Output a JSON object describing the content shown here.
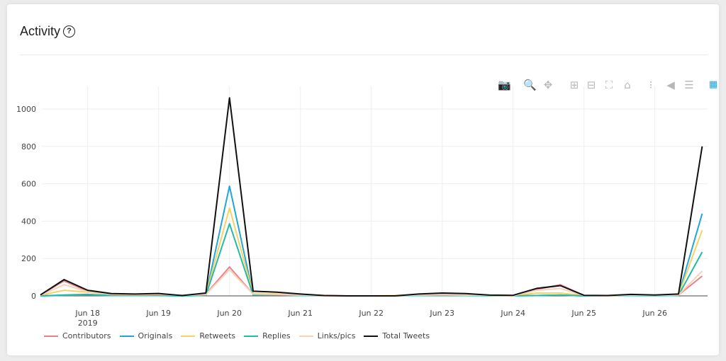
{
  "card": {
    "title": "Activity",
    "help_icon": "question-circle-icon"
  },
  "toolbar": [
    {
      "name": "camera-icon",
      "glyph": "📷",
      "label": "Download plot as png"
    },
    {
      "name": "zoom-icon",
      "glyph": "🔍",
      "label": "Zoom",
      "active": true
    },
    {
      "name": "pan-icon",
      "glyph": "✥",
      "label": "Pan"
    },
    {
      "name": "zoom-in-icon",
      "glyph": "⊞",
      "label": "Zoom in"
    },
    {
      "name": "zoom-out-icon",
      "glyph": "⊟",
      "label": "Zoom out"
    },
    {
      "name": "autoscale-icon",
      "glyph": "⛶",
      "label": "Autoscale"
    },
    {
      "name": "reset-axes-icon",
      "glyph": "⌂",
      "label": "Reset axes"
    },
    {
      "name": "spike-lines-icon",
      "glyph": "⁝",
      "label": "Toggle spike lines"
    },
    {
      "name": "hover-closest-icon",
      "glyph": "◀",
      "label": "Show closest data on hover"
    },
    {
      "name": "hover-compare-icon",
      "glyph": "☰",
      "label": "Compare data on hover"
    },
    {
      "name": "plotly-logo-icon",
      "glyph": "▦",
      "label": "Produced with Plotly"
    }
  ],
  "chart_data": {
    "type": "line",
    "title": "Activity",
    "xlabel": "",
    "ylabel": "",
    "x_unit": "hours since Jun 17 2019 08:00",
    "x_range_hours": [
      0,
      225
    ],
    "ylim": [
      0,
      1080
    ],
    "yticks": [
      0,
      200,
      400,
      600,
      800,
      1000
    ],
    "xticks": [
      {
        "label": "Jun 18",
        "sub": "2019",
        "hour": 16
      },
      {
        "label": "Jun 19",
        "hour": 40
      },
      {
        "label": "Jun 20",
        "hour": 64
      },
      {
        "label": "Jun 21",
        "hour": 88
      },
      {
        "label": "Jun 22",
        "hour": 112
      },
      {
        "label": "Jun 23",
        "hour": 136
      },
      {
        "label": "Jun 24",
        "hour": 160
      },
      {
        "label": "Jun 25",
        "hour": 184
      },
      {
        "label": "Jun 26",
        "hour": 208
      }
    ],
    "grid": true,
    "legend_position": "bottom-left",
    "x": [
      0,
      8,
      16,
      24,
      32,
      40,
      48,
      56,
      64,
      72,
      80,
      88,
      96,
      104,
      112,
      120,
      128,
      136,
      144,
      152,
      160,
      168,
      176,
      184,
      192,
      200,
      208,
      216,
      224
    ],
    "series": [
      {
        "name": "Contributors",
        "color": "#e8828f",
        "values": [
          5,
          80,
          25,
          10,
          8,
          10,
          2,
          10,
          155,
          10,
          10,
          5,
          2,
          0,
          0,
          0,
          5,
          8,
          6,
          2,
          0,
          35,
          60,
          2,
          0,
          5,
          3,
          5,
          106
        ]
      },
      {
        "name": "Originals",
        "color": "#27a4d6",
        "values": [
          0,
          5,
          8,
          2,
          2,
          3,
          0,
          5,
          587,
          8,
          6,
          3,
          0,
          0,
          0,
          0,
          3,
          5,
          3,
          2,
          2,
          2,
          5,
          0,
          0,
          3,
          2,
          5,
          440
        ]
      },
      {
        "name": "Retweets",
        "color": "#f3d366",
        "values": [
          3,
          30,
          20,
          8,
          6,
          8,
          2,
          8,
          470,
          12,
          10,
          5,
          0,
          0,
          0,
          2,
          6,
          8,
          6,
          2,
          0,
          15,
          15,
          2,
          0,
          3,
          2,
          5,
          352
        ]
      },
      {
        "name": "Replies",
        "color": "#26b9a6",
        "values": [
          0,
          3,
          5,
          2,
          2,
          2,
          0,
          3,
          386,
          5,
          4,
          2,
          0,
          0,
          0,
          0,
          2,
          3,
          2,
          0,
          0,
          2,
          4,
          0,
          0,
          2,
          0,
          3,
          235
        ]
      },
      {
        "name": "Links/pics",
        "color": "#f5d2b8",
        "values": [
          3,
          60,
          22,
          8,
          6,
          8,
          2,
          8,
          140,
          10,
          8,
          4,
          0,
          0,
          0,
          0,
          4,
          6,
          4,
          2,
          0,
          30,
          40,
          2,
          0,
          4,
          2,
          5,
          133
        ]
      },
      {
        "name": "Total Tweets",
        "color": "#111111",
        "values": [
          5,
          87,
          30,
          12,
          10,
          13,
          2,
          15,
          1060,
          25,
          20,
          10,
          2,
          0,
          0,
          0,
          10,
          15,
          12,
          4,
          3,
          40,
          55,
          3,
          2,
          8,
          5,
          10,
          800
        ]
      }
    ]
  }
}
